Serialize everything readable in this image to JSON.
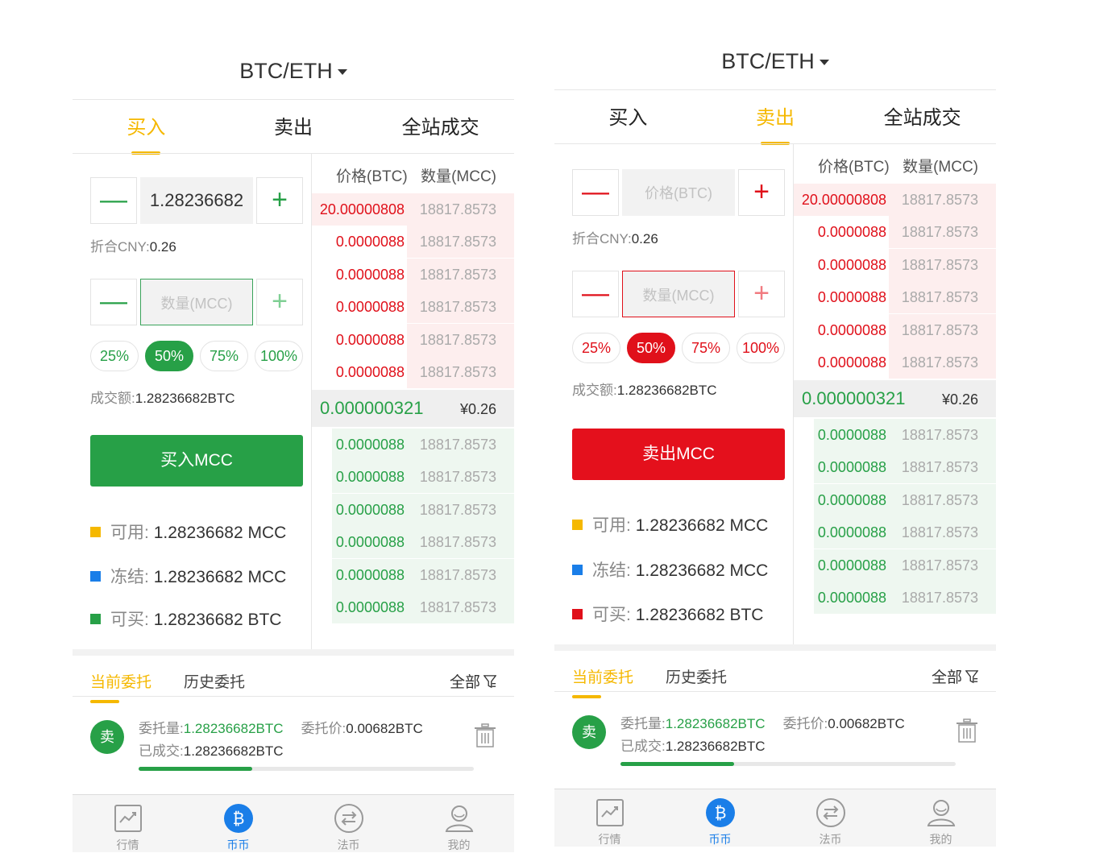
{
  "screens": [
    {
      "title": "BTC/ETH",
      "tabs": [
        "买入",
        "卖出",
        "全站成交"
      ],
      "active_tab": 0,
      "mode": "buy",
      "price_input": {
        "value": "1.28236682",
        "placeholder": "价格(BTC)"
      },
      "cny_note": {
        "label": "折合CNY:",
        "value": "0.26"
      },
      "amount_input": {
        "value": "",
        "placeholder": "数量(MCC)"
      },
      "percents": [
        "25%",
        "50%",
        "75%",
        "100%"
      ],
      "active_percent": 1,
      "turnover": {
        "label": "成交额:",
        "value": "1.28236682BTC"
      },
      "action_label": "买入MCC",
      "balances": [
        {
          "label": "可用:",
          "value": "1.28236682 MCC",
          "color": "#f5b800"
        },
        {
          "label": "冻结:",
          "value": "1.28236682 MCC",
          "color": "#1a7ee8"
        },
        {
          "label": "可买:",
          "value": "1.28236682 BTC",
          "color": "#27a047"
        }
      ],
      "book_headers": {
        "price": "价格(BTC)",
        "qty": "数量(MCC)"
      },
      "asks": [
        {
          "price": "20.00000808",
          "qty": "18817.8573",
          "depth": 1.0
        },
        {
          "price": "0.0000088",
          "qty": "18817.8573",
          "depth": 0.53
        },
        {
          "price": "0.0000088",
          "qty": "18817.8573",
          "depth": 0.53
        },
        {
          "price": "0.0000088",
          "qty": "18817.8573",
          "depth": 0.53
        },
        {
          "price": "0.0000088",
          "qty": "18817.8573",
          "depth": 0.53
        },
        {
          "price": "0.0000088",
          "qty": "18817.8573",
          "depth": 0.53
        }
      ],
      "last_price": "0.000000321",
      "last_cny": "¥0.26",
      "bids": [
        {
          "price": "0.0000088",
          "qty": "18817.8573",
          "depth": 0.9
        },
        {
          "price": "0.0000088",
          "qty": "18817.8573",
          "depth": 0.9
        },
        {
          "price": "0.0000088",
          "qty": "18817.8573",
          "depth": 0.9
        },
        {
          "price": "0.0000088",
          "qty": "18817.8573",
          "depth": 0.9
        },
        {
          "price": "0.0000088",
          "qty": "18817.8573",
          "depth": 0.9
        },
        {
          "price": "0.0000088",
          "qty": "18817.8573",
          "depth": 0.9
        }
      ],
      "order_tabs": [
        "当前委托",
        "历史委托"
      ],
      "filter_label": "全部",
      "order": {
        "badge": "卖",
        "amount_label": "委托量:",
        "amount_value": "1.28236682BTC",
        "price_label": "委托价:",
        "price_value": "0.00682BTC",
        "filled_label": "已成交:",
        "filled_value": "1.28236682BTC",
        "progress": 0.34
      },
      "tabbar": [
        "行情",
        "币币",
        "法币",
        "我的"
      ],
      "active_tabbar": 1
    },
    {
      "title": "BTC/ETH",
      "tabs": [
        "买入",
        "卖出",
        "全站成交"
      ],
      "active_tab": 1,
      "mode": "sell",
      "price_input": {
        "value": "",
        "placeholder": "价格(BTC)"
      },
      "cny_note": {
        "label": "折合CNY:",
        "value": "0.26"
      },
      "amount_input": {
        "value": "",
        "placeholder": "数量(MCC)"
      },
      "percents": [
        "25%",
        "50%",
        "75%",
        "100%"
      ],
      "active_percent": 1,
      "turnover": {
        "label": "成交额:",
        "value": "1.28236682BTC"
      },
      "action_label": "卖出MCC",
      "balances": [
        {
          "label": "可用:",
          "value": "1.28236682 MCC",
          "color": "#f5b800"
        },
        {
          "label": "冻结:",
          "value": "1.28236682 MCC",
          "color": "#1a7ee8"
        },
        {
          "label": "可买:",
          "value": "1.28236682 BTC",
          "color": "#e0101a"
        }
      ],
      "book_headers": {
        "price": "价格(BTC)",
        "qty": "数量(MCC)"
      },
      "asks": [
        {
          "price": "20.00000808",
          "qty": "18817.8573",
          "depth": 1.0
        },
        {
          "price": "0.0000088",
          "qty": "18817.8573",
          "depth": 0.53
        },
        {
          "price": "0.0000088",
          "qty": "18817.8573",
          "depth": 0.53
        },
        {
          "price": "0.0000088",
          "qty": "18817.8573",
          "depth": 0.53
        },
        {
          "price": "0.0000088",
          "qty": "18817.8573",
          "depth": 0.53
        },
        {
          "price": "0.0000088",
          "qty": "18817.8573",
          "depth": 0.53
        }
      ],
      "last_price": "0.000000321",
      "last_cny": "¥0.26",
      "bids": [
        {
          "price": "0.0000088",
          "qty": "18817.8573",
          "depth": 0.9
        },
        {
          "price": "0.0000088",
          "qty": "18817.8573",
          "depth": 0.9
        },
        {
          "price": "0.0000088",
          "qty": "18817.8573",
          "depth": 0.9
        },
        {
          "price": "0.0000088",
          "qty": "18817.8573",
          "depth": 0.9
        },
        {
          "price": "0.0000088",
          "qty": "18817.8573",
          "depth": 0.9
        },
        {
          "price": "0.0000088",
          "qty": "18817.8573",
          "depth": 0.9
        }
      ],
      "order_tabs": [
        "当前委托",
        "历史委托"
      ],
      "filter_label": "全部",
      "order": {
        "badge": "卖",
        "amount_label": "委托量:",
        "amount_value": "1.28236682BTC",
        "price_label": "委托价:",
        "price_value": "0.00682BTC",
        "filled_label": "已成交:",
        "filled_value": "1.28236682BTC",
        "progress": 0.34
      },
      "tabbar": [
        "行情",
        "币币",
        "法币",
        "我的"
      ],
      "active_tabbar": 1
    }
  ]
}
